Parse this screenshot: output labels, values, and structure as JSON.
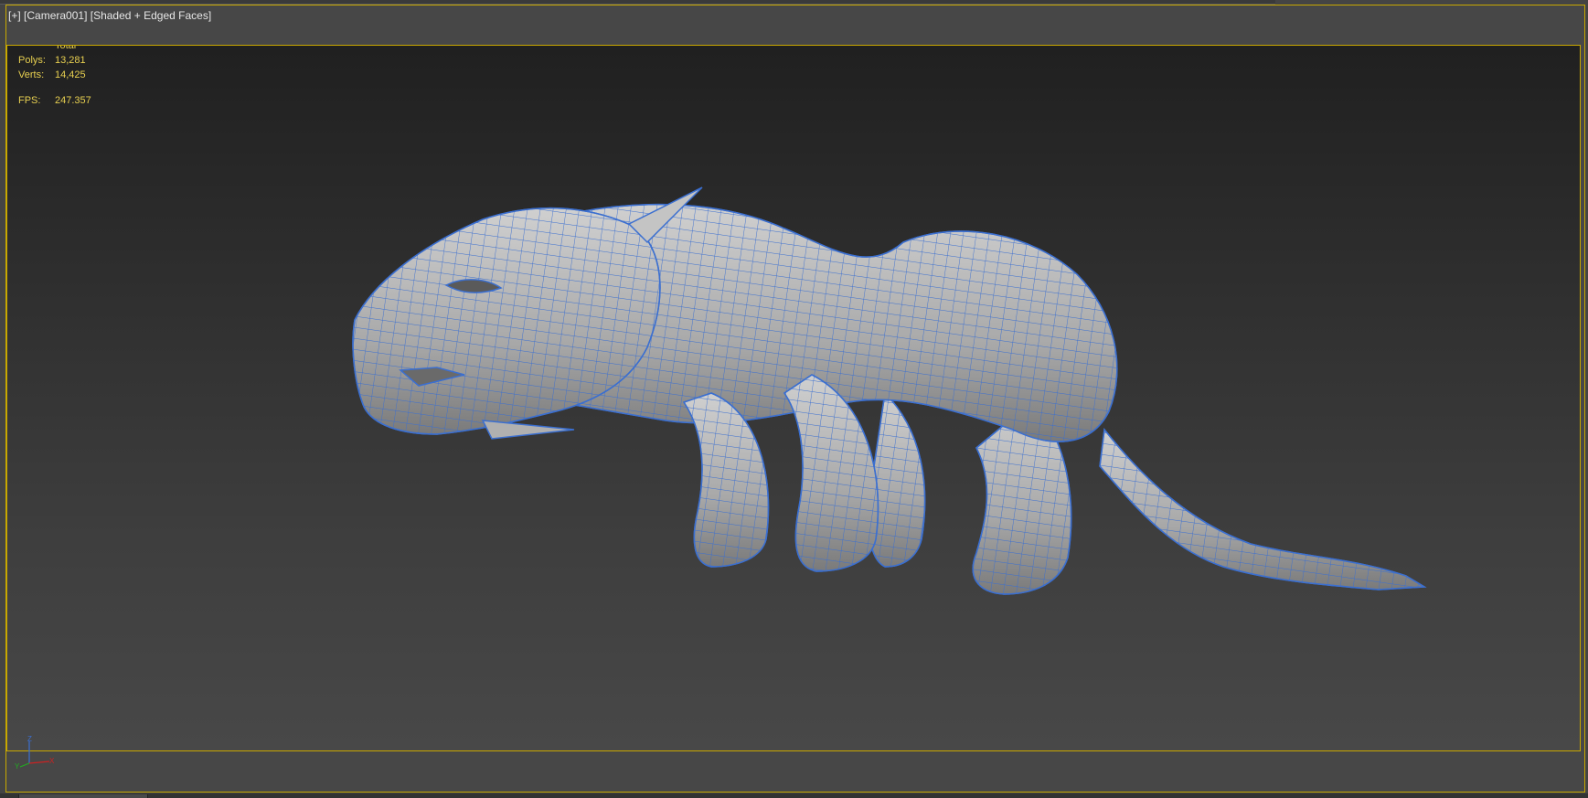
{
  "viewport": {
    "label_plus": "[+]",
    "label_camera": "[Camera001]",
    "label_shading": "[Shaded + Edged Faces]"
  },
  "stats": {
    "header": "Total",
    "polys_label": "Polys:",
    "polys_value": "13,281",
    "verts_label": "Verts:",
    "verts_value": "14,425",
    "fps_label": "FPS:",
    "fps_value": "247.357"
  },
  "axis_gizmo": {
    "x": "X",
    "y": "Y",
    "z": "Z"
  },
  "colors": {
    "frame_active": "#c8a800",
    "stats_text": "#e8d050",
    "wire": "#3b6fd0",
    "mesh": "#b9b9b9"
  },
  "icons": {
    "model": "panther-mesh-wireframe",
    "gizmo": "world-axis-tripod-icon"
  }
}
